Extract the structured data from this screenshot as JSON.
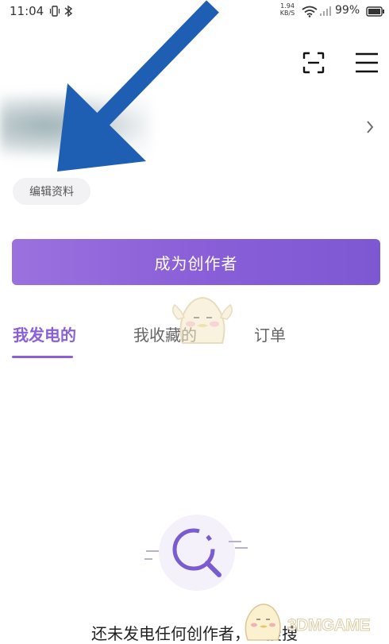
{
  "status_bar": {
    "time": "11:04",
    "net_speed_value": "1.94",
    "net_speed_unit": "KB/S",
    "battery": "99%"
  },
  "header": {
    "scan_icon": "scan-icon",
    "menu_icon": "hamburger-menu-icon"
  },
  "profile": {
    "edit_label": "编辑资料",
    "chevron_icon": "chevron-right-icon"
  },
  "creator_button_label": "成为创作者",
  "tabs": [
    {
      "label": "我发电的",
      "active": true
    },
    {
      "label": "我收藏的",
      "active": false
    },
    {
      "label": "订单",
      "active": false
    }
  ],
  "empty_state": {
    "icon": "search-icon",
    "text": "还未发电任何创作者，去搜搜"
  },
  "watermark": {
    "text": "3DMGAME"
  },
  "colors": {
    "accent": "#8a5fd8",
    "arrow": "#1e5fb4"
  }
}
